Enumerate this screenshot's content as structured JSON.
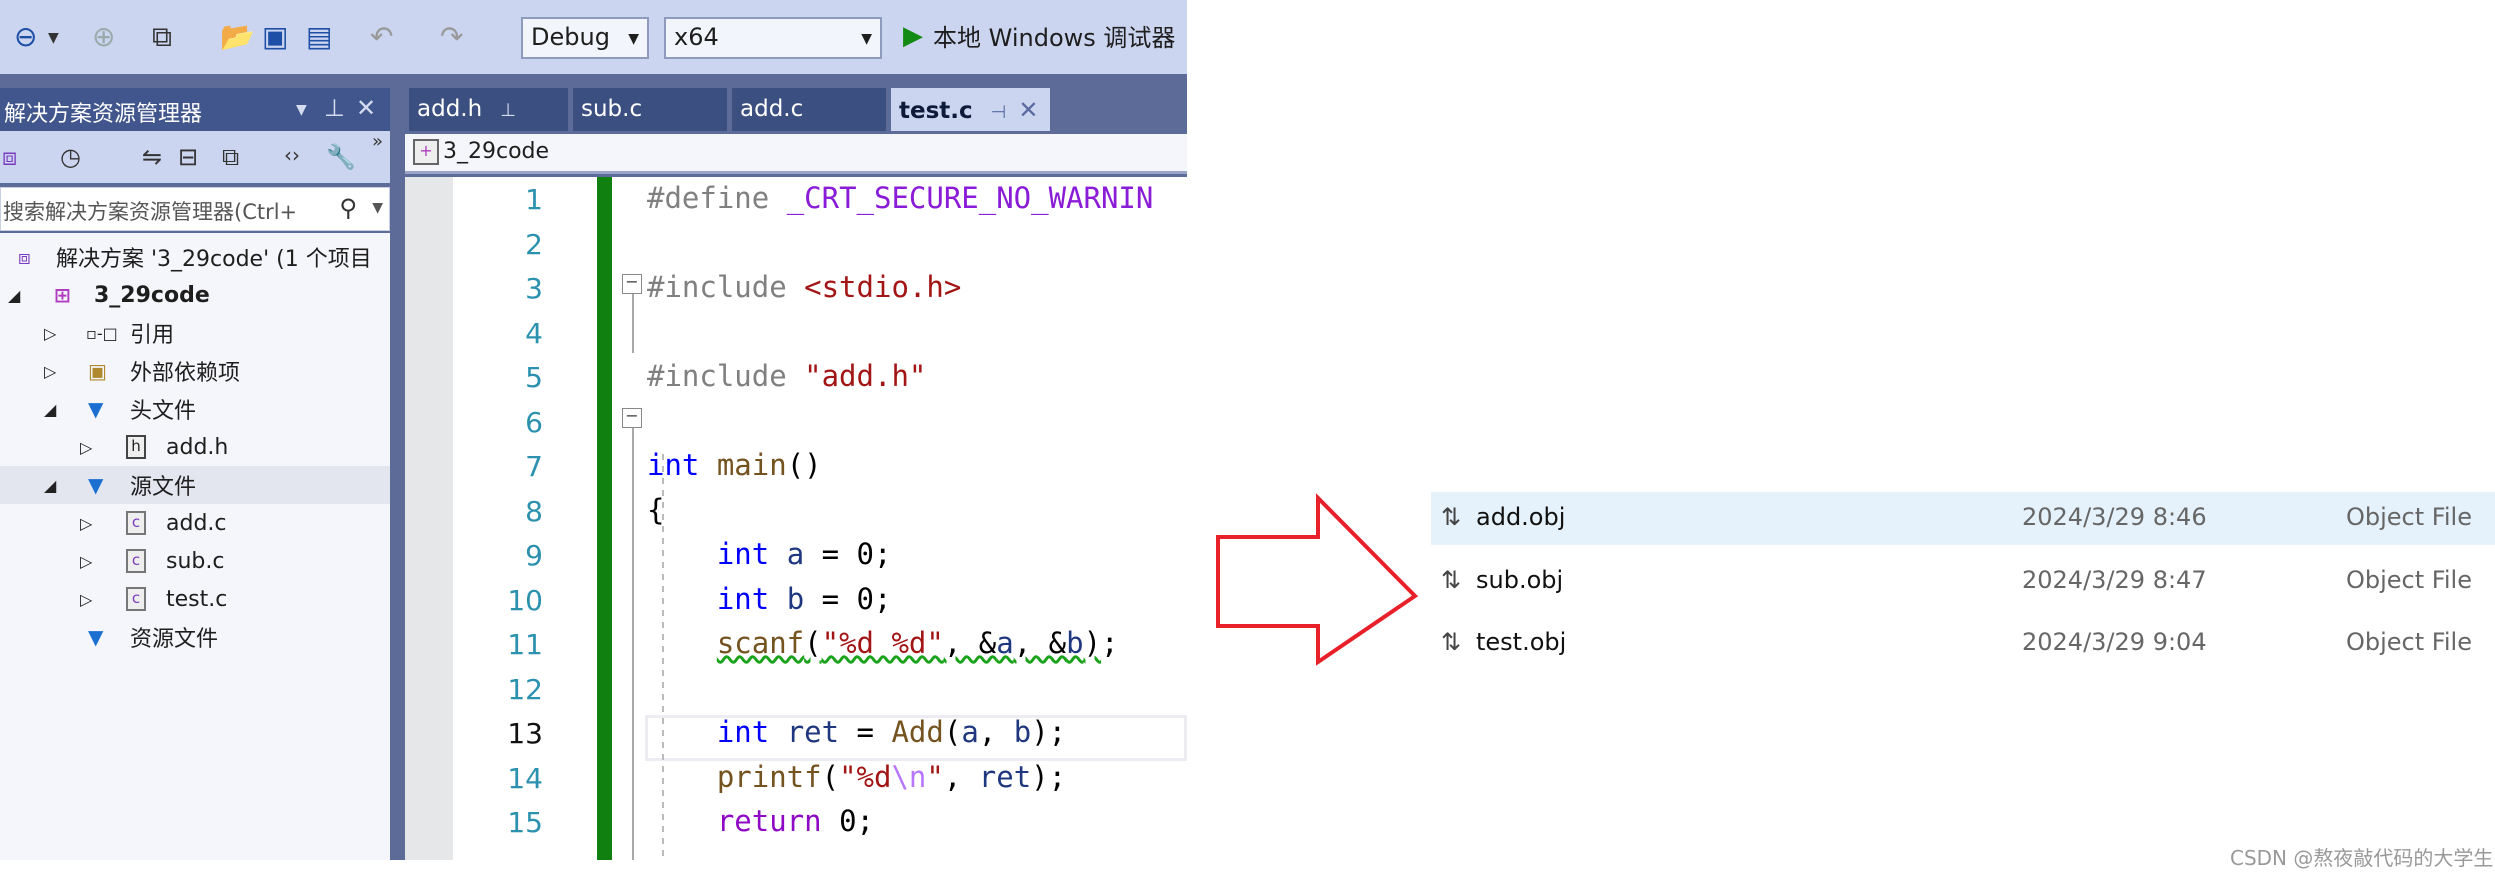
{
  "toolbar": {
    "configuration": "Debug",
    "platform": "x64",
    "run_label": "本地 Windows 调试器"
  },
  "sidebar": {
    "title": "解决方案资源管理器",
    "search_placeholder": "搜索解决方案资源管理器(Ctrl+",
    "tree": [
      {
        "label": "解决方案 '3_29code' (1 个项目",
        "icon": "solution-icon"
      },
      {
        "label": "3_29code",
        "icon": "project-icon"
      },
      {
        "label": "引用",
        "icon": "references-icon"
      },
      {
        "label": "外部依赖项",
        "icon": "external-deps-icon"
      },
      {
        "label": "头文件",
        "icon": "filter-folder-icon"
      },
      {
        "label": "add.h",
        "icon": "header-file-icon"
      },
      {
        "label": "源文件",
        "icon": "filter-folder-icon"
      },
      {
        "label": "add.c",
        "icon": "c-file-icon"
      },
      {
        "label": "sub.c",
        "icon": "c-file-icon"
      },
      {
        "label": "test.c",
        "icon": "c-file-icon"
      },
      {
        "label": "资源文件",
        "icon": "filter-folder-icon"
      }
    ]
  },
  "tabs": [
    {
      "label": "add.h",
      "pinned": true
    },
    {
      "label": "sub.c"
    },
    {
      "label": "add.c"
    },
    {
      "label": "test.c",
      "active": true,
      "pinned": true
    }
  ],
  "breadcrumb": "3_29code",
  "editor": {
    "current_line": 13,
    "lines": [
      {
        "n": "1",
        "tokens": [
          [
            "#define ",
            "pp"
          ],
          [
            "_CRT_SECURE_NO_WARNIN",
            "mac"
          ]
        ]
      },
      {
        "n": "2",
        "tokens": []
      },
      {
        "n": "3",
        "tokens": [
          [
            "#include ",
            "pp"
          ],
          [
            "<stdio.h>",
            "str"
          ]
        ]
      },
      {
        "n": "4",
        "tokens": []
      },
      {
        "n": "5",
        "tokens": [
          [
            "#include ",
            "pp"
          ],
          [
            "\"add.h\"",
            "str"
          ]
        ]
      },
      {
        "n": "6",
        "tokens": []
      },
      {
        "n": "7",
        "tokens": [
          [
            "int",
            "k"
          ],
          [
            " main",
            "fn"
          ],
          [
            "()",
            "plain"
          ]
        ]
      },
      {
        "n": "8",
        "tokens": [
          [
            "{",
            "plain"
          ]
        ]
      },
      {
        "n": "9",
        "tokens": [
          [
            "    ",
            "plain"
          ],
          [
            "int",
            "k"
          ],
          [
            " a",
            "var"
          ],
          [
            " = 0;",
            "plain"
          ]
        ]
      },
      {
        "n": "10",
        "tokens": [
          [
            "    ",
            "plain"
          ],
          [
            "int",
            "k"
          ],
          [
            " b",
            "var"
          ],
          [
            " = 0;",
            "plain"
          ]
        ]
      },
      {
        "n": "11",
        "tokens": [
          [
            "    ",
            "plain"
          ],
          [
            "scanf",
            "fn squig"
          ],
          [
            "(",
            "plain squig"
          ],
          [
            "\"%d %d\"",
            "str squig"
          ],
          [
            ", &",
            "plain squig"
          ],
          [
            "a",
            "var squig"
          ],
          [
            ", &",
            "plain squig"
          ],
          [
            "b",
            "var squig"
          ],
          [
            ")",
            "plain squig"
          ],
          [
            ";",
            "plain"
          ]
        ]
      },
      {
        "n": "12",
        "tokens": []
      },
      {
        "n": "13",
        "tokens": [
          [
            "    ",
            "plain"
          ],
          [
            "int",
            "k"
          ],
          [
            " ret",
            "var"
          ],
          [
            " = ",
            "plain"
          ],
          [
            "Add",
            "fn"
          ],
          [
            "(",
            "plain"
          ],
          [
            "a",
            "var"
          ],
          [
            ", ",
            "plain"
          ],
          [
            "b",
            "var"
          ],
          [
            ");",
            "plain"
          ]
        ]
      },
      {
        "n": "14",
        "tokens": [
          [
            "    ",
            "plain"
          ],
          [
            "printf",
            "fn"
          ],
          [
            "(",
            "plain"
          ],
          [
            "\"%d",
            "str"
          ],
          [
            "\\n",
            "esc"
          ],
          [
            "\"",
            "str"
          ],
          [
            ", ",
            "plain"
          ],
          [
            "ret",
            "var"
          ],
          [
            ");",
            "plain"
          ]
        ]
      },
      {
        "n": "15",
        "tokens": [
          [
            "    ",
            "plain"
          ],
          [
            "return",
            "ctl"
          ],
          [
            " 0;",
            "plain"
          ]
        ]
      }
    ]
  },
  "object_files": [
    {
      "name": "add.obj",
      "date": "2024/3/29 8:46",
      "type": "Object File",
      "highlighted": true
    },
    {
      "name": "sub.obj",
      "date": "2024/3/29 8:47",
      "type": "Object File"
    },
    {
      "name": "test.obj",
      "date": "2024/3/29 9:04",
      "type": "Object File"
    }
  ],
  "annotation": {
    "arrow_color": "#e8202a"
  },
  "watermark": "CSDN @熬夜敲代码的大学生"
}
